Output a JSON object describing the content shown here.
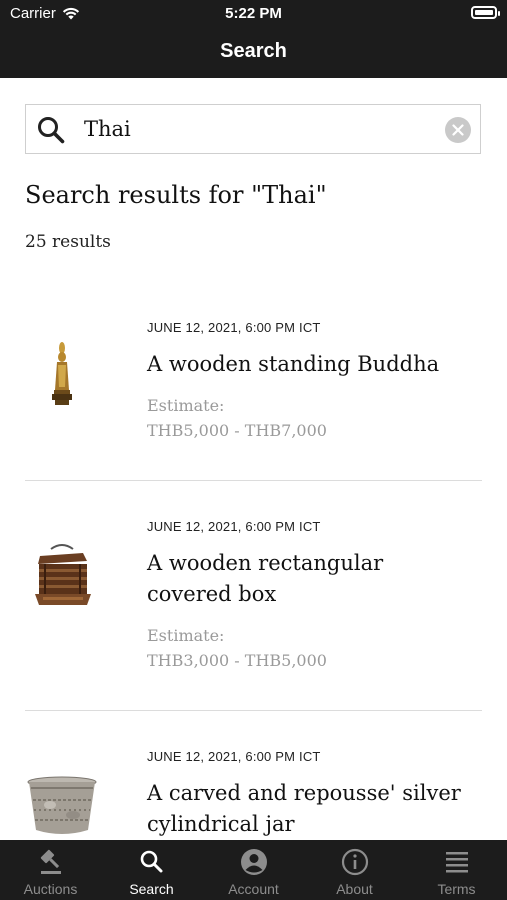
{
  "status_bar": {
    "carrier": "Carrier",
    "time": "5:22 PM",
    "battery_level": 1.0
  },
  "nav": {
    "title": "Search"
  },
  "search": {
    "value": "Thai"
  },
  "results": {
    "title": "Search results for \"Thai\"",
    "count": "25 results",
    "items": [
      {
        "date": "JUNE 12, 2021, 6:00 PM ICT",
        "title": "A wooden standing Buddha",
        "estimate_label": "Estimate:",
        "estimate": "THB5,000 - THB7,000",
        "thumb_icon": "buddha-statue-image"
      },
      {
        "date": "JUNE 12, 2021, 6:00 PM ICT",
        "title": "A wooden rectangular covered box",
        "estimate_label": "Estimate:",
        "estimate": "THB3,000 - THB5,000",
        "thumb_icon": "wooden-box-image"
      },
      {
        "date": "JUNE 12, 2021, 6:00 PM ICT",
        "title": "A carved and repousse' silver cylindrical jar",
        "thumb_icon": "silver-jar-image"
      }
    ]
  },
  "tabbar": {
    "tabs": [
      {
        "label": "Auctions",
        "icon": "gavel-icon",
        "active": false
      },
      {
        "label": "Search",
        "icon": "search-icon",
        "active": true
      },
      {
        "label": "Account",
        "icon": "account-icon",
        "active": false
      },
      {
        "label": "About",
        "icon": "info-icon",
        "active": false
      },
      {
        "label": "Terms",
        "icon": "terms-icon",
        "active": false
      }
    ]
  }
}
